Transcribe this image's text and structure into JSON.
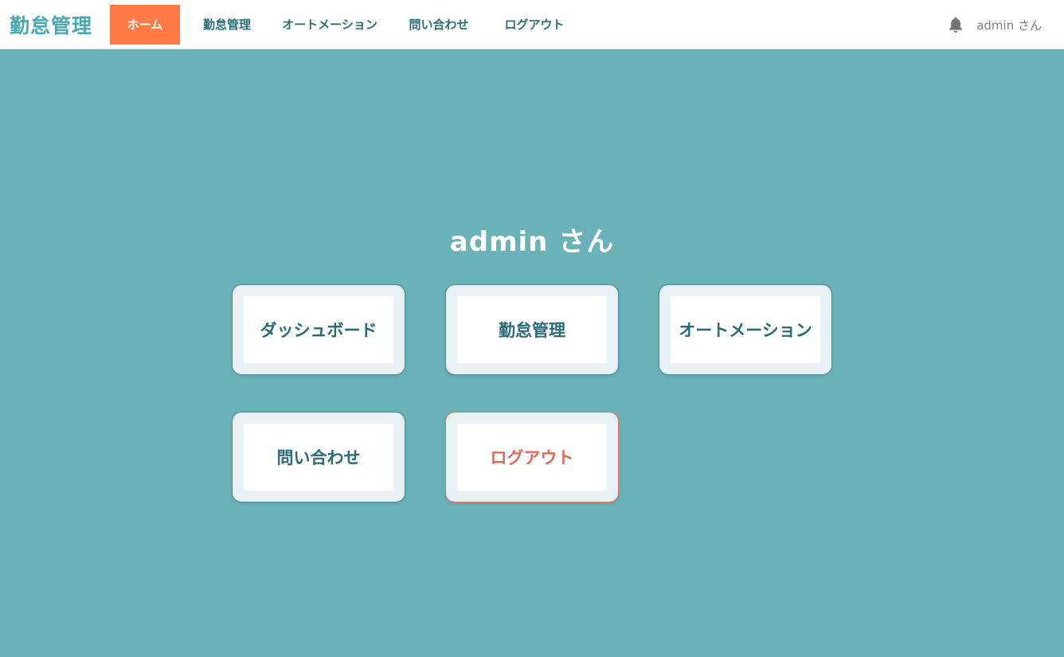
{
  "header": {
    "brand": "勤怠管理",
    "nav": [
      {
        "label": "ホーム",
        "active": true
      },
      {
        "label": "勤怠管理",
        "active": false
      },
      {
        "label": "オートメーション",
        "active": false
      },
      {
        "label": "問い合わせ",
        "active": false
      },
      {
        "label": "ログアウト",
        "active": false
      }
    ],
    "notification_icon": "bell-icon",
    "user_label": "admin さん"
  },
  "main": {
    "greeting": "admin さん",
    "cards": [
      {
        "label": "ダッシュボード"
      },
      {
        "label": "勤怠管理"
      },
      {
        "label": "オートメーション"
      },
      {
        "label": "問い合わせ"
      },
      {
        "label": "ログアウト"
      }
    ]
  },
  "colors": {
    "background": "#6bb1b8",
    "brand": "#48a9b0",
    "active_nav": "#ff7a45",
    "card_text": "#2b6b78",
    "logout_accent": "#e06a5a"
  }
}
